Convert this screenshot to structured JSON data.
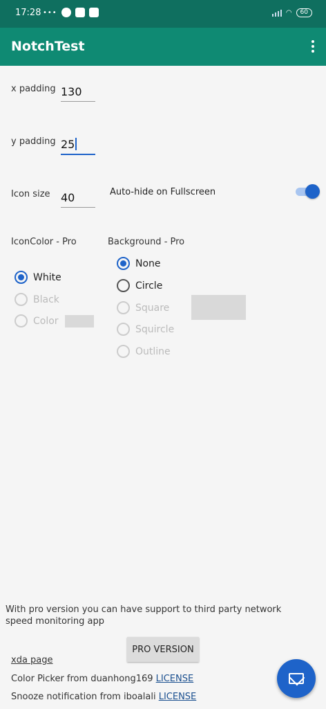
{
  "status_bar": {
    "time": "17:28",
    "dots": "•••",
    "battery": "60"
  },
  "app_bar": {
    "title": "NotchTest"
  },
  "settings": {
    "x_padding_label": "x padding",
    "x_padding_value": "130",
    "y_padding_label": "y padding",
    "y_padding_value": "25",
    "icon_size_label": "Icon size",
    "icon_size_value": "40",
    "auto_hide_label": "Auto-hide on Fullscreen",
    "auto_hide_enabled": true
  },
  "icon_color": {
    "heading": "IconColor - Pro",
    "options": [
      "White",
      "Black",
      "Color"
    ],
    "selected": "White"
  },
  "background": {
    "heading": "Background - Pro",
    "options": [
      "None",
      "Circle",
      "Square",
      "Squircle",
      "Outline"
    ],
    "selected": "None"
  },
  "footer": {
    "pro_text": "With pro version you can have support to third party network speed monitoring app",
    "pro_button": "PRO VERSION",
    "xda_link": "xda page",
    "color_picker_text": "Color Picker from duanhong169",
    "license": "LICENSE",
    "snooze_text": "Snooze notification from iboalali"
  },
  "colors": {
    "app_bar": "#0f8a73",
    "status_bar": "#0f6f5f",
    "accent": "#1e63c9"
  }
}
